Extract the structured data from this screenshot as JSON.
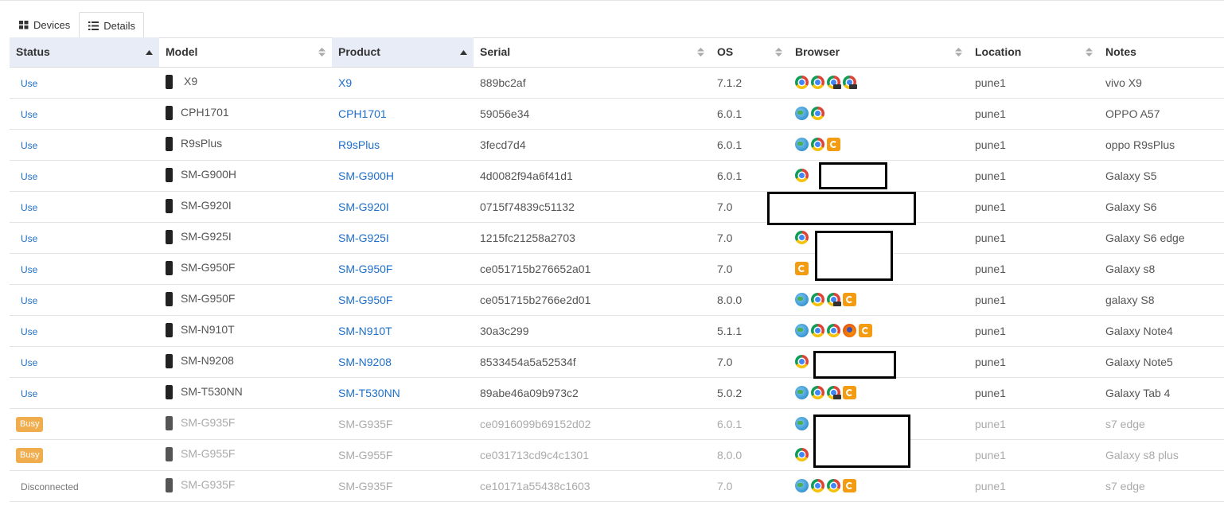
{
  "tabs": [
    {
      "label": "Devices",
      "icon": "grid-icon",
      "active": false
    },
    {
      "label": "Details",
      "icon": "list-icon",
      "active": true
    }
  ],
  "columns": [
    {
      "label": "Status",
      "sort": "asc",
      "sorted": true
    },
    {
      "label": "Model",
      "sort": "both",
      "sorted": false
    },
    {
      "label": "Product",
      "sort": "asc",
      "sorted": true
    },
    {
      "label": "Serial",
      "sort": "both",
      "sorted": false
    },
    {
      "label": "OS",
      "sort": "both",
      "sorted": false
    },
    {
      "label": "Browser",
      "sort": "both",
      "sorted": false
    },
    {
      "label": "Location",
      "sort": "both",
      "sorted": false
    },
    {
      "label": "Notes",
      "sort": "none",
      "sorted": false
    }
  ],
  "rows": [
    {
      "status": "Use",
      "status_type": "use",
      "model": "X9",
      "product": "X9",
      "serial": "889bc2af",
      "os": "7.1.2",
      "browsers": [
        "chrome",
        "chrome",
        "chrome-beta",
        "chrome-beta"
      ],
      "location": "pune1",
      "notes": "vivo X9"
    },
    {
      "status": "Use",
      "status_type": "use",
      "model": "CPH1701",
      "product": "CPH1701",
      "serial": "59056e34",
      "os": "6.0.1",
      "browsers": [
        "globe",
        "chrome"
      ],
      "location": "pune1",
      "notes": "OPPO A57"
    },
    {
      "status": "Use",
      "status_type": "use",
      "model": "R9sPlus",
      "product": "R9sPlus",
      "serial": "3fecd7d4",
      "os": "6.0.1",
      "browsers": [
        "globe",
        "chrome",
        "uc"
      ],
      "location": "pune1",
      "notes": "oppo R9sPlus"
    },
    {
      "status": "Use",
      "status_type": "use",
      "model": "SM-G900H",
      "product": "SM-G900H",
      "serial": "4d0082f94a6f41d1",
      "os": "6.0.1",
      "browsers": [
        "chrome"
      ],
      "location": "pune1",
      "notes": "Galaxy S5"
    },
    {
      "status": "Use",
      "status_type": "use",
      "model": "SM-G920I",
      "product": "SM-G920I",
      "serial": "0715f74839c51132",
      "os": "7.0",
      "browsers": [],
      "location": "pune1",
      "notes": "Galaxy S6"
    },
    {
      "status": "Use",
      "status_type": "use",
      "model": "SM-G925I",
      "product": "SM-G925I",
      "serial": "1215fc21258a2703",
      "os": "7.0",
      "browsers": [
        "chrome"
      ],
      "location": "pune1",
      "notes": "Galaxy S6 edge"
    },
    {
      "status": "Use",
      "status_type": "use",
      "model": "SM-G950F",
      "product": "SM-G950F",
      "serial": "ce051715b276652a01",
      "os": "7.0",
      "browsers": [
        "uc"
      ],
      "location": "pune1",
      "notes": "Galaxy s8"
    },
    {
      "status": "Use",
      "status_type": "use",
      "model": "SM-G950F",
      "product": "SM-G950F",
      "serial": "ce051715b2766e2d01",
      "os": "8.0.0",
      "browsers": [
        "globe",
        "chrome",
        "chrome-beta",
        "uc"
      ],
      "location": "pune1",
      "notes": "galaxy S8"
    },
    {
      "status": "Use",
      "status_type": "use",
      "model": "SM-N910T",
      "product": "SM-N910T",
      "serial": "30a3c299",
      "os": "5.1.1",
      "browsers": [
        "globe",
        "chrome",
        "chrome",
        "firefox",
        "uc"
      ],
      "location": "pune1",
      "notes": "Galaxy Note4"
    },
    {
      "status": "Use",
      "status_type": "use",
      "model": "SM-N9208",
      "product": "SM-N9208",
      "serial": "8533454a5a52534f",
      "os": "7.0",
      "browsers": [
        "chrome"
      ],
      "location": "pune1",
      "notes": "Galaxy Note5"
    },
    {
      "status": "Use",
      "status_type": "use",
      "model": "SM-T530NN",
      "product": "SM-T530NN",
      "serial": "89abe46a09b973c2",
      "os": "5.0.2",
      "browsers": [
        "globe",
        "chrome",
        "chrome-beta",
        "uc"
      ],
      "location": "pune1",
      "notes": "Galaxy Tab 4"
    },
    {
      "status": "Busy",
      "status_type": "busy",
      "model": "SM-G935F",
      "product": "SM-G935F",
      "serial": "ce0916099b69152d02",
      "os": "6.0.1",
      "browsers": [
        "globe"
      ],
      "location": "pune1",
      "notes": "s7 edge"
    },
    {
      "status": "Busy",
      "status_type": "busy",
      "model": "SM-G955F",
      "product": "SM-G955F",
      "serial": "ce031713cd9c4c1301",
      "os": "8.0.0",
      "browsers": [
        "chrome"
      ],
      "location": "pune1",
      "notes": "Galaxy s8 plus"
    },
    {
      "status": "Disconnected",
      "status_type": "disconnected",
      "model": "SM-G935F",
      "product": "SM-G935F",
      "serial": "ce10171a55438c1603",
      "os": "7.0",
      "browsers": [
        "globe",
        "chrome",
        "chrome",
        "uc"
      ],
      "location": "pune1",
      "notes": "s7 edge"
    }
  ],
  "colors": {
    "link": "#1e6fc9",
    "busy": "#f0ad4e",
    "sorted_header": "#e8ecf7"
  }
}
